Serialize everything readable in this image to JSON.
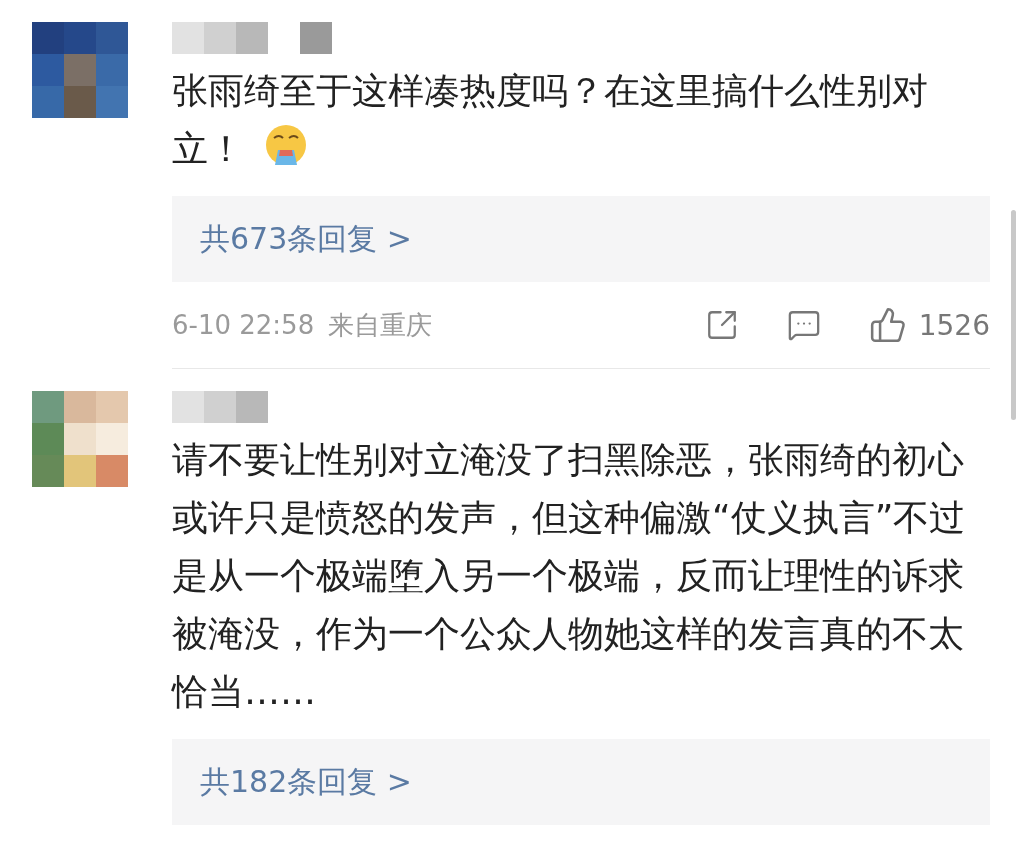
{
  "comments": [
    {
      "text": "张雨绮至于这样凑热度吗？在这里搞什么性别对立！",
      "has_emoji": true,
      "replies": "共673条回复 >",
      "meta": {
        "time": "6-10 22:58",
        "source": "来自重庆",
        "likes": "1526"
      }
    },
    {
      "text": "请不要让性别对立淹没了扫黑除恶，张雨绮的初心或许只是愤怒的发声，但这种偏激“仗义执言”不过是从一个极端堕入另一个极端，反而让理性的诉求被淹没，作为一个公众人物她这样的发言真的不太恰当……",
      "has_emoji": false,
      "replies": "共182条回复 >"
    }
  ]
}
